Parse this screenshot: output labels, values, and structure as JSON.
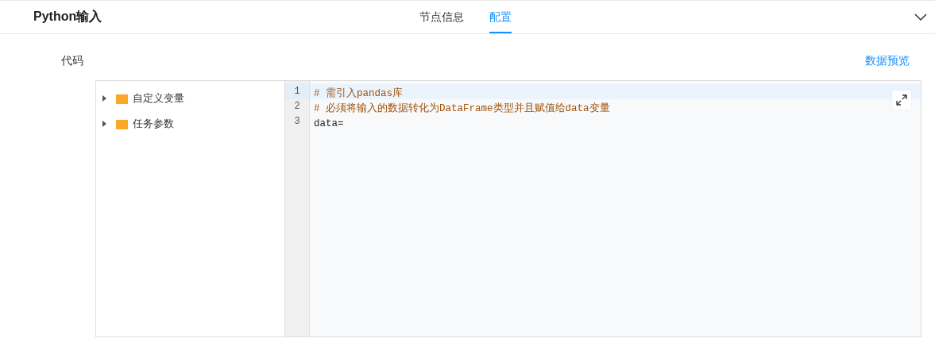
{
  "header": {
    "title": "Python输入",
    "tabs": [
      {
        "label": "节点信息",
        "selected": false
      },
      {
        "label": "配置",
        "selected": true
      }
    ]
  },
  "section": {
    "label": "代码",
    "link": "数据预览"
  },
  "tree": [
    {
      "label": "自定义变量",
      "expanded": false
    },
    {
      "label": "任务参数",
      "expanded": false
    }
  ],
  "editor": {
    "lines": [
      {
        "number": "1",
        "text": "# 需引入pandas库",
        "kind": "comment",
        "active": true
      },
      {
        "number": "2",
        "text": "# 必须将输入的数据转化为DataFrame类型并且赋值给data变量",
        "kind": "comment",
        "active": false
      },
      {
        "number": "3",
        "text": "data=",
        "kind": "code",
        "active": false
      }
    ]
  }
}
